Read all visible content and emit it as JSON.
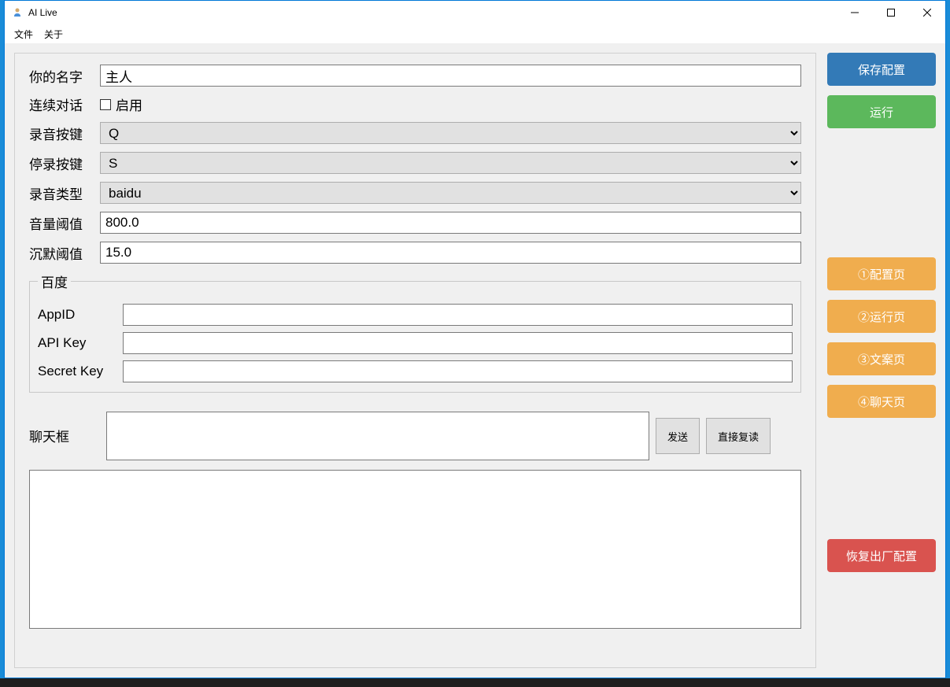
{
  "window": {
    "title": "AI Live",
    "min_tip": "—",
    "max_tip": "☐",
    "close_tip": "✕"
  },
  "menu": {
    "file": "文件",
    "about": "关于"
  },
  "form": {
    "name_label": "你的名字",
    "name_value": "主人",
    "cont_label": "连续对话",
    "cont_checkbox_label": "启用",
    "rec_key_label": "录音按键",
    "rec_key_value": "Q",
    "stop_key_label": "停录按键",
    "stop_key_value": "S",
    "rec_type_label": "录音类型",
    "rec_type_value": "baidu",
    "vol_label": "音量阈值",
    "vol_value": "800.0",
    "silence_label": "沉默阈值",
    "silence_value": "15.0"
  },
  "baidu": {
    "legend": "百度",
    "appid_label": "AppID",
    "appid_value": "",
    "apikey_label": "API Key",
    "apikey_value": "",
    "secret_label": "Secret Key",
    "secret_value": ""
  },
  "chat": {
    "label": "聊天框",
    "input_value": "",
    "send_label": "发送",
    "repeat_label": "直接复读"
  },
  "log": {
    "value": ""
  },
  "side": {
    "save": "保存配置",
    "run": "运行",
    "page1": "①配置页",
    "page2": "②运行页",
    "page3": "③文案页",
    "page4": "④聊天页",
    "reset": "恢复出厂配置"
  }
}
